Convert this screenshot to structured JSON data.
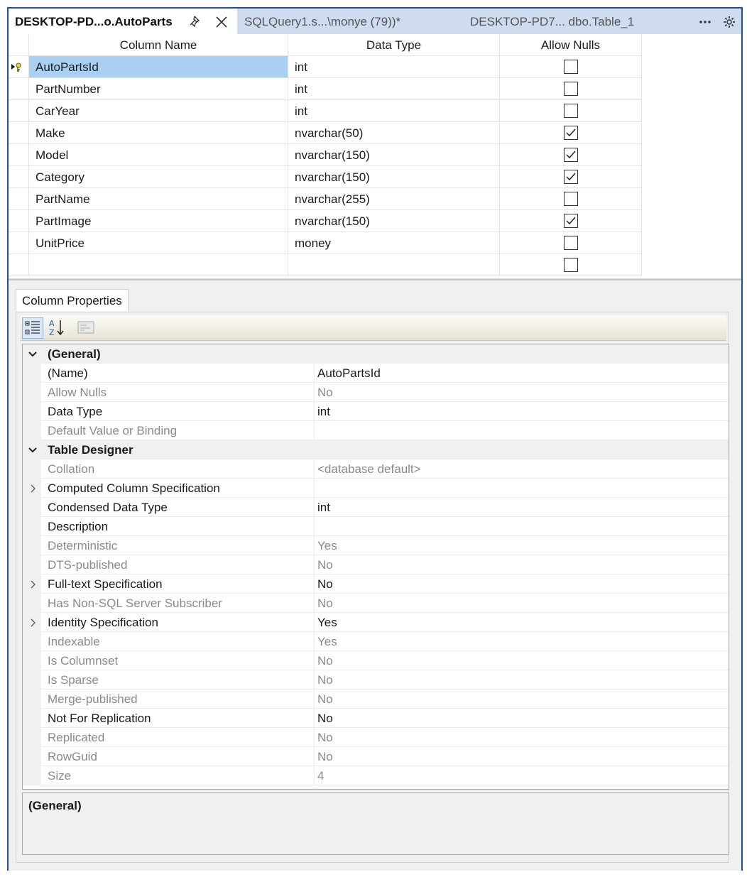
{
  "tabs": [
    {
      "label": "DESKTOP-PD...o.AutoParts",
      "active": true
    },
    {
      "label": "SQLQuery1.s...\\monye (79))*",
      "active": false
    },
    {
      "label": "DESKTOP-PD7... dbo.Table_1",
      "active": false
    }
  ],
  "grid": {
    "headers": [
      "Column Name",
      "Data Type",
      "Allow Nulls"
    ],
    "rows": [
      {
        "name": "AutoPartsId",
        "type": "int",
        "allow_nulls": false,
        "primary_key": true,
        "selected": true
      },
      {
        "name": "PartNumber",
        "type": "int",
        "allow_nulls": false
      },
      {
        "name": "CarYear",
        "type": "int",
        "allow_nulls": false
      },
      {
        "name": "Make",
        "type": "nvarchar(50)",
        "allow_nulls": true
      },
      {
        "name": "Model",
        "type": "nvarchar(150)",
        "allow_nulls": true
      },
      {
        "name": "Category",
        "type": "nvarchar(150)",
        "allow_nulls": true
      },
      {
        "name": "PartName",
        "type": "nvarchar(255)",
        "allow_nulls": false
      },
      {
        "name": "PartImage",
        "type": "nvarchar(150)",
        "allow_nulls": true
      },
      {
        "name": "UnitPrice",
        "type": "money",
        "allow_nulls": false
      },
      {
        "name": "",
        "type": "",
        "allow_nulls": false
      }
    ]
  },
  "column_properties": {
    "tab_label": "Column Properties",
    "rows": [
      {
        "kind": "category",
        "name": "(General)",
        "value": "",
        "expanded": true
      },
      {
        "kind": "prop",
        "name": "(Name)",
        "value": "AutoPartsId",
        "dim": false
      },
      {
        "kind": "prop",
        "name": "Allow Nulls",
        "value": "No",
        "dim": true
      },
      {
        "kind": "prop",
        "name": "Data Type",
        "value": "int",
        "dim": false
      },
      {
        "kind": "prop",
        "name": "Default Value or Binding",
        "value": "",
        "dim": true
      },
      {
        "kind": "category",
        "name": "Table Designer",
        "value": "",
        "expanded": true
      },
      {
        "kind": "prop",
        "name": "Collation",
        "value": "<database default>",
        "dim": true
      },
      {
        "kind": "prop",
        "name": "Computed Column Specification",
        "value": "",
        "dim": false,
        "expandable": true
      },
      {
        "kind": "prop",
        "name": "Condensed Data Type",
        "value": "int",
        "dim": false
      },
      {
        "kind": "prop",
        "name": "Description",
        "value": "",
        "dim": false
      },
      {
        "kind": "prop",
        "name": "Deterministic",
        "value": "Yes",
        "dim": true
      },
      {
        "kind": "prop",
        "name": "DTS-published",
        "value": "No",
        "dim": true
      },
      {
        "kind": "prop",
        "name": "Full-text Specification",
        "value": "No",
        "dim": false,
        "expandable": true
      },
      {
        "kind": "prop",
        "name": "Has Non-SQL Server Subscriber",
        "value": "No",
        "dim": true
      },
      {
        "kind": "prop",
        "name": "Identity Specification",
        "value": "Yes",
        "dim": false,
        "expandable": true
      },
      {
        "kind": "prop",
        "name": "Indexable",
        "value": "Yes",
        "dim": true
      },
      {
        "kind": "prop",
        "name": "Is Columnset",
        "value": "No",
        "dim": true
      },
      {
        "kind": "prop",
        "name": "Is Sparse",
        "value": "No",
        "dim": true
      },
      {
        "kind": "prop",
        "name": "Merge-published",
        "value": "No",
        "dim": true
      },
      {
        "kind": "prop",
        "name": "Not For Replication",
        "value": "No",
        "dim": false
      },
      {
        "kind": "prop",
        "name": "Replicated",
        "value": "No",
        "dim": true
      },
      {
        "kind": "prop",
        "name": "RowGuid",
        "value": "No",
        "dim": true
      },
      {
        "kind": "prop",
        "name": "Size",
        "value": "4",
        "dim": true
      }
    ],
    "description_title": "(General)"
  },
  "icons": {
    "pin": "pin-icon",
    "close": "close-icon",
    "overflow": "more-icon",
    "settings": "gear-icon",
    "categorized": "categorized-icon",
    "alphabetical": "sort-az-icon",
    "property_pages": "property-pages-icon",
    "primary_key": "key-icon"
  },
  "colors": {
    "accent_border": "#1f4e98",
    "tab_strip": "#cfdcef",
    "selected_cell": "#a9cff1"
  }
}
